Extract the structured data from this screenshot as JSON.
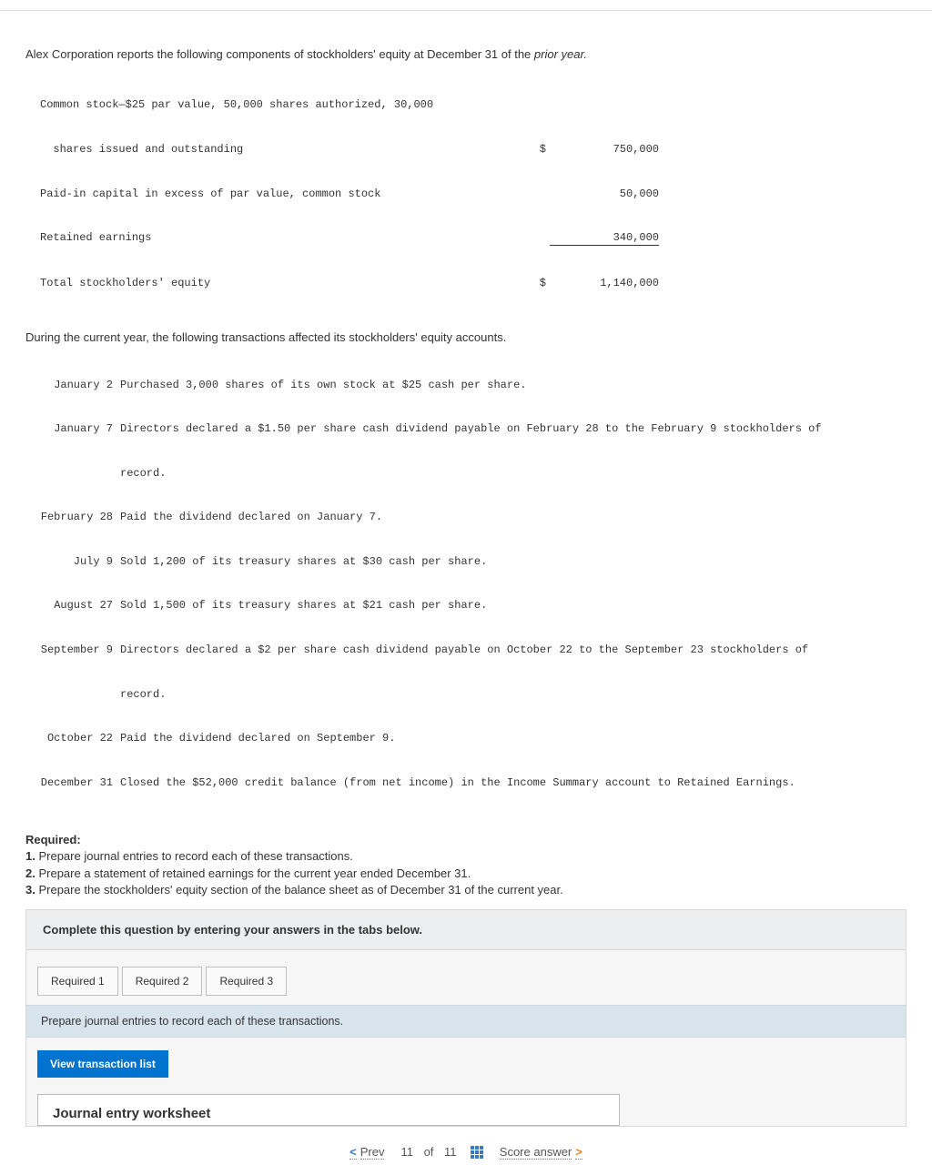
{
  "intro": "Alex Corporation reports the following components of stockholders' equity at December 31 of the ",
  "intro_em": "prior year.",
  "equity": {
    "rows": [
      {
        "label": "Common stock—$25 par value, 50,000 shares authorized, 30,000",
        "sign": "",
        "value": ""
      },
      {
        "label": "  shares issued and outstanding",
        "sign": "$",
        "value": "750,000"
      },
      {
        "label": "Paid-in capital in excess of par value, common stock",
        "sign": "",
        "value": "50,000"
      },
      {
        "label": "Retained earnings",
        "sign": "",
        "value": "340,000",
        "underline": true
      },
      {
        "label": "Total stockholders' equity",
        "sign": "$",
        "value": "1,140,000"
      }
    ]
  },
  "mid_para": "During the current year, the following transactions affected its stockholders' equity accounts.",
  "transactions": [
    {
      "date": "January 2",
      "desc": "Purchased 3,000 shares of its own stock at $25 cash per share."
    },
    {
      "date": "January 7",
      "desc": "Directors declared a $1.50 per share cash dividend payable on February 28 to the February 9 stockholders of"
    },
    {
      "date": "",
      "desc": "record."
    },
    {
      "date": "February 28",
      "desc": "Paid the dividend declared on January 7."
    },
    {
      "date": "July 9",
      "desc": "Sold 1,200 of its treasury shares at $30 cash per share."
    },
    {
      "date": "August 27",
      "desc": "Sold 1,500 of its treasury shares at $21 cash per share."
    },
    {
      "date": "September 9",
      "desc": "Directors declared a $2 per share cash dividend payable on October 22 to the September 23 stockholders of"
    },
    {
      "date": "",
      "desc": "record."
    },
    {
      "date": "October 22",
      "desc": "Paid the dividend declared on September 9."
    },
    {
      "date": "December 31",
      "desc": "Closed the $52,000 credit balance (from net income) in the Income Summary account to Retained Earnings."
    }
  ],
  "required": {
    "head": "Required:",
    "items": [
      "Prepare journal entries to record each of these transactions.",
      "Prepare a statement of retained earnings for the current year ended December 31.",
      "Prepare the stockholders' equity section of the balance sheet as of December 31 of the current year."
    ]
  },
  "instr_bar": "Complete this question by entering your answers in the tabs below.",
  "tabs": [
    "Required 1",
    "Required 2",
    "Required 3"
  ],
  "subtask": "Prepare journal entries to record each of these transactions.",
  "view_btn": "View transaction list",
  "ws_title": "Journal entry worksheet",
  "footer": {
    "prev": "Prev",
    "pos": "11",
    "of": "of",
    "total": "11",
    "score": "Score answer"
  }
}
